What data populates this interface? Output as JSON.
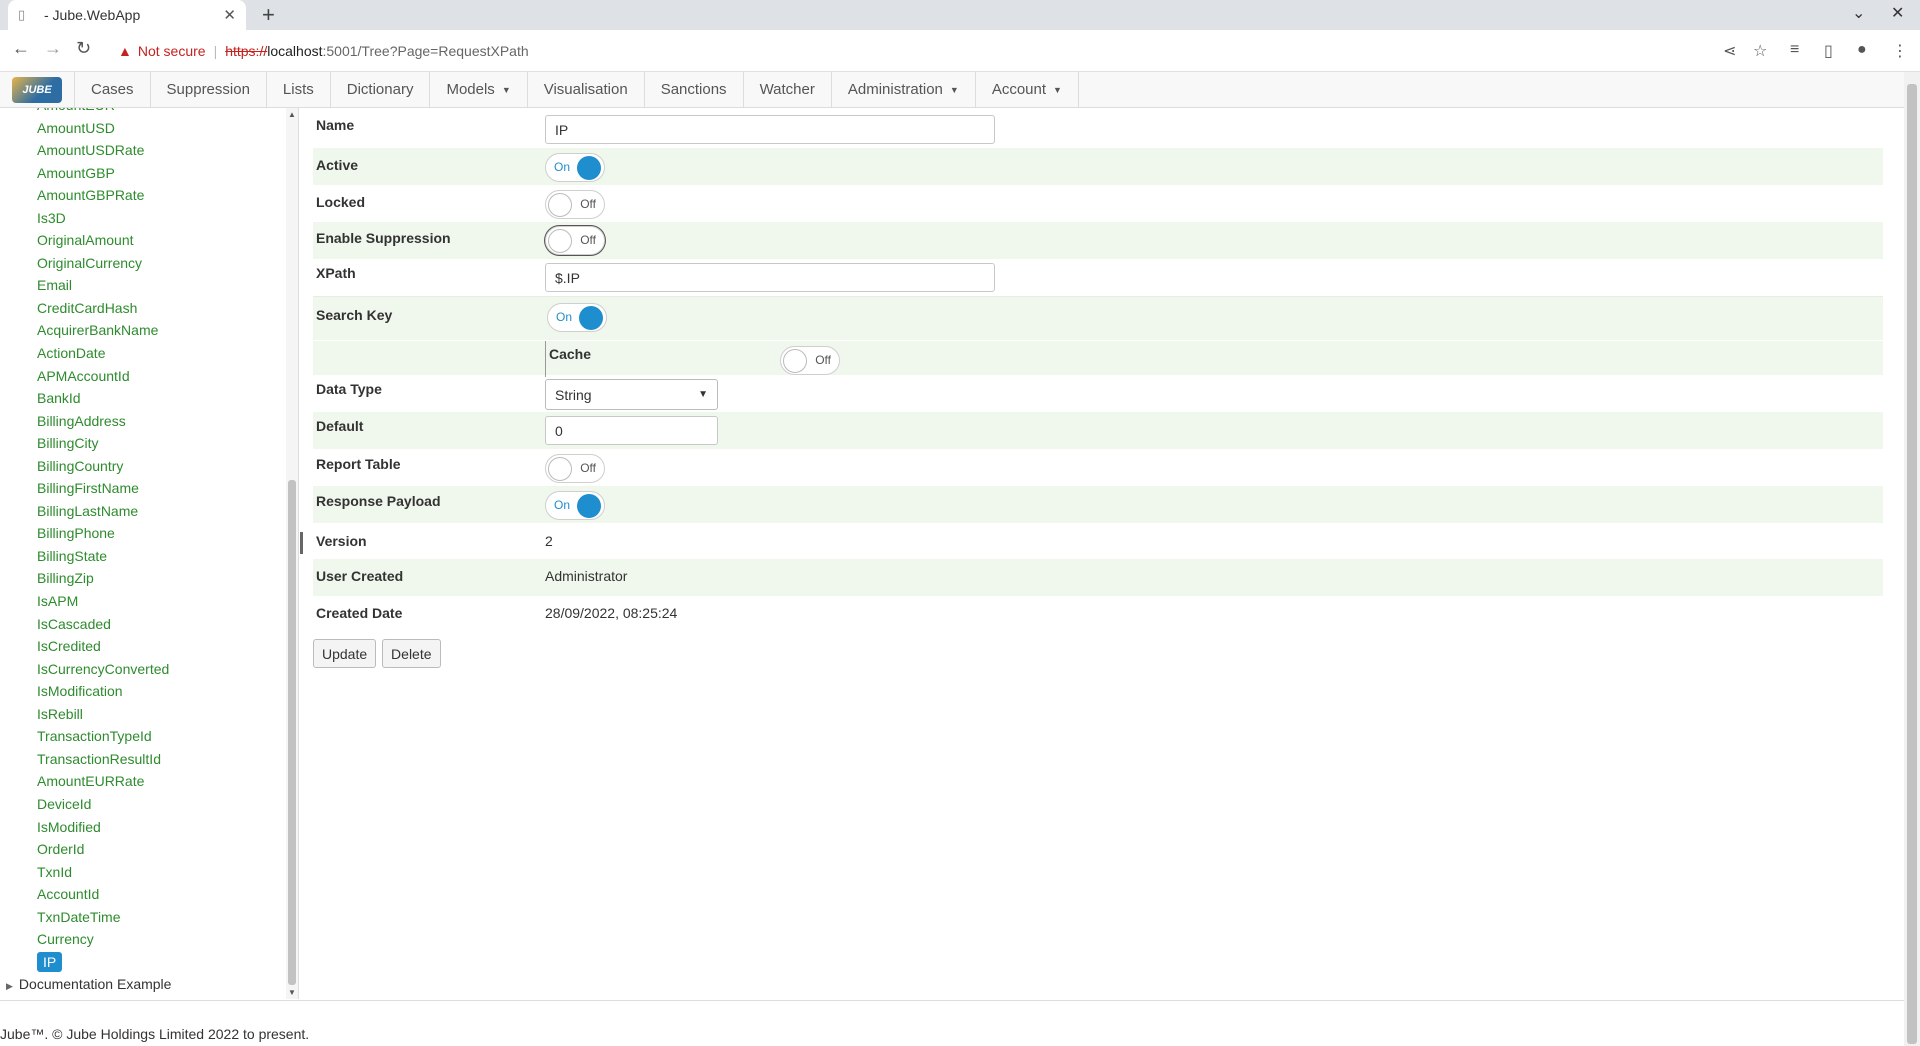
{
  "browser": {
    "tab_title": "- Jube.WebApp",
    "new_tab_icon": "plus-icon",
    "url_warning": "Not secure",
    "url_protocol": "https://",
    "url_host": "localhost",
    "url_path": ":5001/Tree?Page=RequestXPath"
  },
  "navbar": {
    "logo_text": "JUBE",
    "items": [
      {
        "label": "Cases",
        "caret": false
      },
      {
        "label": "Suppression",
        "caret": false
      },
      {
        "label": "Lists",
        "caret": false
      },
      {
        "label": "Dictionary",
        "caret": false
      },
      {
        "label": "Models",
        "caret": true
      },
      {
        "label": "Visualisation",
        "caret": false
      },
      {
        "label": "Sanctions",
        "caret": false
      },
      {
        "label": "Watcher",
        "caret": false
      },
      {
        "label": "Administration",
        "caret": true
      },
      {
        "label": "Account",
        "caret": true
      }
    ]
  },
  "tree": {
    "items": [
      "AmountEUR",
      "AmountUSD",
      "AmountUSDRate",
      "AmountGBP",
      "AmountGBPRate",
      "Is3D",
      "OriginalAmount",
      "OriginalCurrency",
      "Email",
      "CreditCardHash",
      "AcquirerBankName",
      "ActionDate",
      "APMAccountId",
      "BankId",
      "BillingAddress",
      "BillingCity",
      "BillingCountry",
      "BillingFirstName",
      "BillingLastName",
      "BillingPhone",
      "BillingState",
      "BillingZip",
      "IsAPM",
      "IsCascaded",
      "IsCredited",
      "IsCurrencyConverted",
      "IsModification",
      "IsRebill",
      "TransactionTypeId",
      "TransactionResultId",
      "AmountEURRate",
      "DeviceId",
      "IsModified",
      "OrderId",
      "TxnId",
      "AccountId",
      "TxnDateTime",
      "Currency"
    ],
    "selected": "IP",
    "root_label": "Documentation Example"
  },
  "form": {
    "name_label": "Name",
    "name_value": "IP",
    "active_label": "Active",
    "active_state": "On",
    "locked_label": "Locked",
    "locked_state": "Off",
    "suppression_label": "Enable Suppression",
    "suppression_state": "Off",
    "xpath_label": "XPath",
    "xpath_value": "$.IP",
    "search_key_label": "Search Key",
    "search_key_state": "On",
    "cache_label": "Cache",
    "cache_state": "Off",
    "data_type_label": "Data Type",
    "data_type_value": "String",
    "default_label": "Default",
    "default_value": "0",
    "report_table_label": "Report Table",
    "report_table_state": "Off",
    "response_payload_label": "Response Payload",
    "response_payload_state": "On",
    "version_label": "Version",
    "version_value": "2",
    "user_created_label": "User Created",
    "user_created_value": "Administrator",
    "created_date_label": "Created Date",
    "created_date_value": "28/09/2022, 08:25:24",
    "update_button": "Update",
    "delete_button": "Delete"
  },
  "footer": {
    "text": "Jube™. © Jube Holdings Limited 2022 to present."
  },
  "colors": {
    "accent": "#1e8ecf",
    "tree_link": "#2e8b2e",
    "row_shade": "#f0f7ec"
  }
}
